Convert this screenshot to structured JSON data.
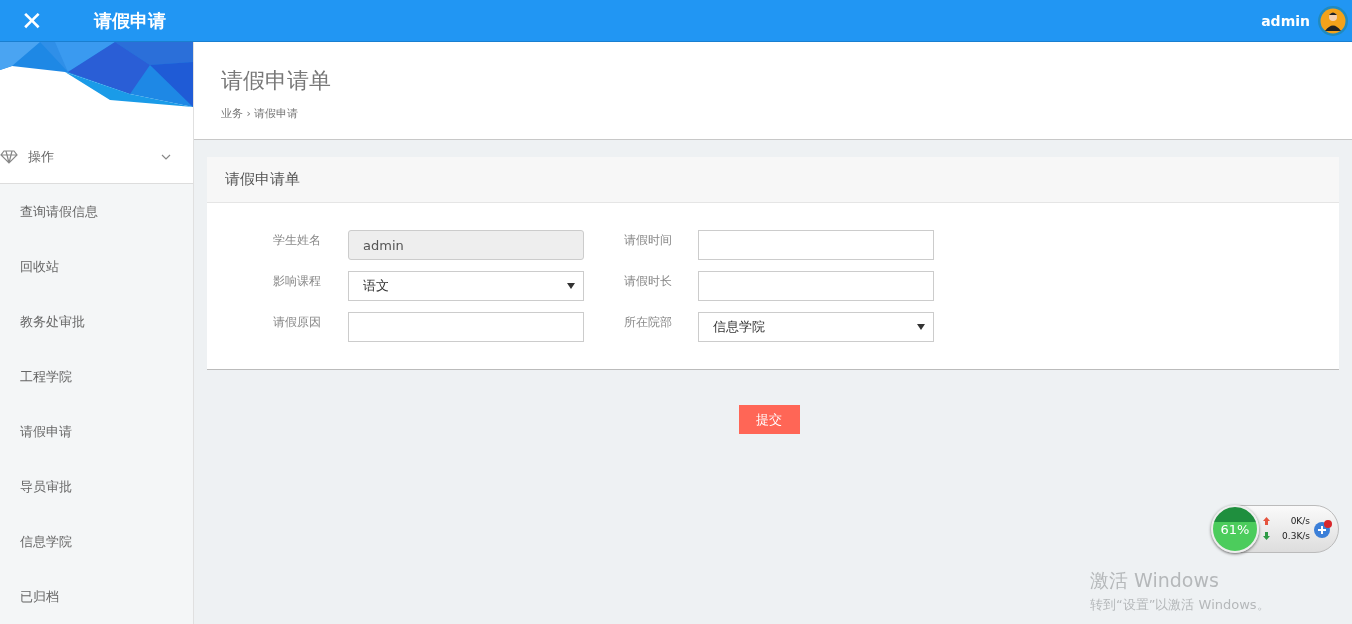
{
  "header": {
    "close_icon": "✕",
    "title": "请假申请",
    "user": "admin"
  },
  "sidebar": {
    "group": {
      "label": "操作",
      "expanded": true
    },
    "items": [
      {
        "label": "查询请假信息",
        "selected": false
      },
      {
        "label": "回收站",
        "selected": false
      },
      {
        "label": "教务处审批",
        "selected": false
      },
      {
        "label": "工程学院",
        "selected": false
      },
      {
        "label": "请假申请",
        "selected": false
      },
      {
        "label": "导员审批",
        "selected": false
      },
      {
        "label": "信息学院",
        "selected": false
      },
      {
        "label": "已归档",
        "selected": false
      }
    ]
  },
  "page": {
    "title": "请假申请单",
    "breadcrumb": {
      "items": [
        "业务",
        "请假申请"
      ],
      "separator": "›"
    }
  },
  "form": {
    "title": "请假申请单",
    "fields": [
      {
        "label": "学生姓名",
        "kind": "input",
        "value": "admin",
        "disabled": true
      },
      {
        "label": "请假时间",
        "kind": "input",
        "disabled": false
      },
      {
        "label": "影响课程",
        "kind": "select",
        "value": "语文",
        "disabled": false
      },
      {
        "label": "请假时长",
        "kind": "input",
        "disabled": false
      },
      {
        "label": "请假原因",
        "kind": "input",
        "disabled": false
      },
      {
        "label": "所在院部",
        "kind": "select",
        "value": "信息学院",
        "disabled": false
      }
    ],
    "submit": "提交"
  },
  "net_widget": {
    "percent": "61%",
    "upload": "0K/s",
    "download": "0.3K/s"
  },
  "windows_activation": {
    "title": "激活 Windows",
    "message": "转到“设置”以激活 Windows。"
  }
}
